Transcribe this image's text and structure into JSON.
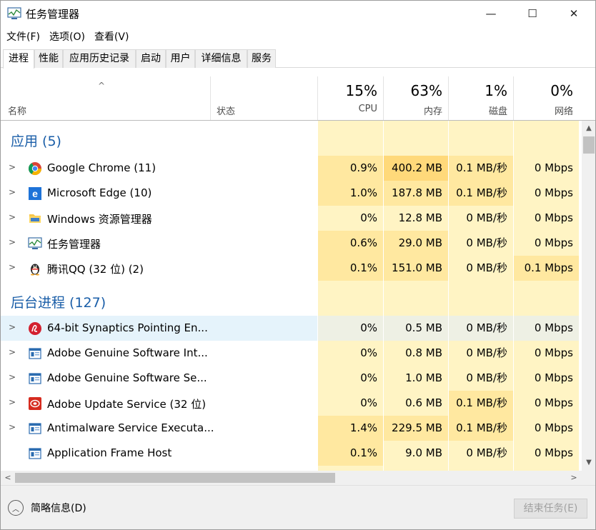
{
  "window": {
    "title": "任务管理器",
    "buttons": {
      "minimize": "—",
      "maximize": "☐",
      "close": "✕"
    }
  },
  "menu": [
    "文件(F)",
    "选项(O)",
    "查看(V)"
  ],
  "tabs": [
    "进程",
    "性能",
    "应用历史记录",
    "启动",
    "用户",
    "详细信息",
    "服务"
  ],
  "active_tab": "进程",
  "header": {
    "sort_arrow": "^",
    "name_label": "名称",
    "status_label": "状态",
    "cpu": {
      "pct": "15%",
      "label": "CPU"
    },
    "memory": {
      "pct": "63%",
      "label": "内存"
    },
    "disk": {
      "pct": "1%",
      "label": "磁盘"
    },
    "network": {
      "pct": "0%",
      "label": "网络"
    }
  },
  "groups": [
    {
      "title": "应用 (5)",
      "rows": [
        {
          "name": "Google Chrome (11)",
          "icon": "chrome-icon",
          "expandable": true,
          "cpu": "0.9%",
          "mem": "400.2 MB",
          "disk": "0.1 MB/秒",
          "net": "0 Mbps"
        },
        {
          "name": "Microsoft Edge (10)",
          "icon": "edge-icon",
          "expandable": true,
          "cpu": "1.0%",
          "mem": "187.8 MB",
          "disk": "0.1 MB/秒",
          "net": "0 Mbps"
        },
        {
          "name": "Windows 资源管理器",
          "icon": "folder-icon",
          "expandable": true,
          "cpu": "0%",
          "mem": "12.8 MB",
          "disk": "0 MB/秒",
          "net": "0 Mbps"
        },
        {
          "name": "任务管理器",
          "icon": "task-manager-icon",
          "expandable": true,
          "cpu": "0.6%",
          "mem": "29.0 MB",
          "disk": "0 MB/秒",
          "net": "0 Mbps"
        },
        {
          "name": "腾讯QQ (32 位) (2)",
          "icon": "qq-penguin-icon",
          "expandable": true,
          "cpu": "0.1%",
          "mem": "151.0 MB",
          "disk": "0 MB/秒",
          "net": "0.1 Mbps"
        }
      ]
    },
    {
      "title": "后台进程 (127)",
      "rows": [
        {
          "name": "64-bit Synaptics Pointing En...",
          "icon": "synaptics-icon",
          "expandable": true,
          "selected": true,
          "cpu": "0%",
          "mem": "0.5 MB",
          "disk": "0 MB/秒",
          "net": "0 Mbps"
        },
        {
          "name": "Adobe Genuine Software Int...",
          "icon": "service-window-icon",
          "expandable": true,
          "cpu": "0%",
          "mem": "0.8 MB",
          "disk": "0 MB/秒",
          "net": "0 Mbps"
        },
        {
          "name": "Adobe Genuine Software Se...",
          "icon": "service-window-icon",
          "expandable": true,
          "cpu": "0%",
          "mem": "1.0 MB",
          "disk": "0 MB/秒",
          "net": "0 Mbps"
        },
        {
          "name": "Adobe Update Service (32 位)",
          "icon": "adobe-icon",
          "expandable": true,
          "cpu": "0%",
          "mem": "0.6 MB",
          "disk": "0.1 MB/秒",
          "net": "0 Mbps"
        },
        {
          "name": "Antimalware Service Executa...",
          "icon": "service-window-icon",
          "expandable": true,
          "cpu": "1.4%",
          "mem": "229.5 MB",
          "disk": "0.1 MB/秒",
          "net": "0 Mbps"
        },
        {
          "name": "Application Frame Host",
          "icon": "service-window-icon",
          "expandable": false,
          "cpu": "0.1%",
          "mem": "9.0 MB",
          "disk": "0 MB/秒",
          "net": "0 Mbps"
        }
      ]
    }
  ],
  "footer": {
    "fewer_details": "简略信息(D)",
    "end_task": "结束任务(E)"
  },
  "colors": {
    "heat_light": "#fff4c4",
    "heat_medium": "#ffe8a0",
    "heat_strong": "#ffd97a",
    "group_title": "#1a5ea8",
    "selected": "#e5f3fb"
  }
}
